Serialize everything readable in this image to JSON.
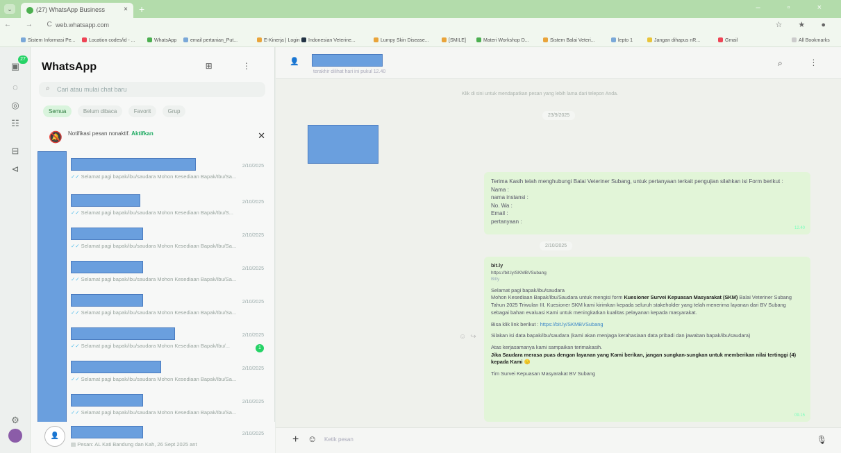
{
  "browser": {
    "tab_title": "(27) WhatsApp Business",
    "tab_close": "×",
    "new_tab": "+",
    "window_controls": "– ▫ ×",
    "nav_icons": "← → C",
    "url": "web.whatsapp.com",
    "addr_right": "☆ ★ ●",
    "bookmarks": [
      "Sistem Informasi Pe...",
      "Location codes/id - ...",
      "WhatsApp",
      "email pertanian_Put...",
      "E-Kinerja | Login",
      "Indonesian Veterine...",
      "Lumpy Skin Disease...",
      "[SMILE]",
      "Materi Workshop D...",
      "Sistem Balai Veteri...",
      "lepto 1",
      "Jangan dihapus nR...",
      "Gmail",
      "All Bookmarks"
    ]
  },
  "rail": {
    "badge": "27",
    "icons": [
      "chats-icon",
      "status-icon",
      "channels-icon",
      "communities-icon",
      "catalog-icon",
      "tools-icon"
    ]
  },
  "chatlist": {
    "title": "WhatsApp",
    "header_icons": "⊞ ⋮",
    "search_placeholder": "Cari atau mulai chat baru",
    "filters": [
      "Semua",
      "Belum dibaca",
      "Favorit",
      "Grup"
    ],
    "notification_text": "Notifikasi pesan nonaktif.",
    "notification_action": "Aktifkan",
    "rows": [
      {
        "time": "2/10/2025",
        "preview": "Selamat pagi bapak/ibu/saudara Mohon Kesediaan Bapak/Ibu/Sa..."
      },
      {
        "time": "2/10/2025",
        "preview": "Selamat pagi bapak/ibu/saudara Mohon Kesediaan Bapak/Ibu/S..."
      },
      {
        "time": "2/10/2025",
        "preview": "Selamat pagi bapak/ibu/saudara Mohon Kesediaan Bapak/Ibu/Sa..."
      },
      {
        "time": "2/10/2025",
        "preview": "Selamat pagi bapak/ibu/saudara Mohon Kesediaan Bapak/Ibu/Sa..."
      },
      {
        "time": "2/10/2025",
        "preview": "Selamat pagi bapak/ibu/saudara Mohon Kesediaan Bapak/Ibu/Sa..."
      },
      {
        "time": "2/10/2025",
        "preview": "Selamat pagi bapak/ibu/saudara Mohon Kesediaan Bapak/Ibu/...",
        "unread": "1"
      },
      {
        "time": "2/10/2025",
        "preview": "Selamat pagi bapak/ibu/saudara Mohon Kesediaan Bapak/Ibu/Sa..."
      },
      {
        "time": "2/10/2025",
        "preview": "Selamat pagi bapak/ibu/saudara Mohon Kesediaan Bapak/Ibu/Sa..."
      },
      {
        "time": "2/10/2025",
        "preview": "Pesan: AL Kati Bandung dan Kah, 26 Sept 2025 ant"
      }
    ]
  },
  "conversation": {
    "subtitle": "terakhir dilihat hari ini pukul 12.40",
    "header_icons": "⌕ ⋮",
    "system_message": "Klik di sini untuk mendapatkan pesan yang lebih lama dari telepon Anda.",
    "date1": "23/9/2025",
    "date2": "2/10/2025",
    "form_bubble": {
      "intro": "Terima Kasih telah menghubungi Balai Veteriner Subang, untuk pertanyaan terkait pengujian silahkan isi Form berikut :",
      "fields": [
        "Nama :",
        "nama instansi :",
        "No. Wa :",
        "Email :",
        "pertanyaan :"
      ],
      "time": "12.40"
    },
    "survey_bubble": {
      "site": "bit.ly",
      "site_url": "https://bit.ly/SKMBVSubang",
      "site_sub": "Bitly",
      "greeting": "Selamat pagi bapak/ibu/saudara",
      "line1_pre": "Mohon Kesediaan Bapak/Ibu/Saudara untuk mengisi form ",
      "line1_bold": "Kuesioner Survei Kepuasan Masyarakat (SKM)",
      "line1_post": " Balai Veteriner Subang Tahun 2025 Triwulan III. Kuesioner SKM kami kirimkan kepada seluruh stakeholder yang telah menerima layanan dari BV Subang sebagai bahan evaluasi Kami untuk meningkatkan kualitas pelayanan kepada masyarakat.",
      "link_pre": "Bisa klik link berikut : ",
      "link": "https://bit.ly/SKMBVSubang",
      "privacy": "Silakan isi data bapak/ibu/saudara (kami akan menjaga kerahasiaan data pribadi dan jawaban bapak/ibu/saudara)",
      "thanks": "Atas kerjasamanya kami sampaikan terimakasih.",
      "bold_close": "Jika Saudara merasa puas dengan layanan yang Kami berikan, jangan sungkan-sungkan untuk memberikan nilai tertinggi (4) kepada Kami 🙂",
      "signature": "Tim Survei Kepuasan Masyarakat BV Subang",
      "time": "09.15"
    },
    "composer_placeholder": "Ketik pesan"
  }
}
